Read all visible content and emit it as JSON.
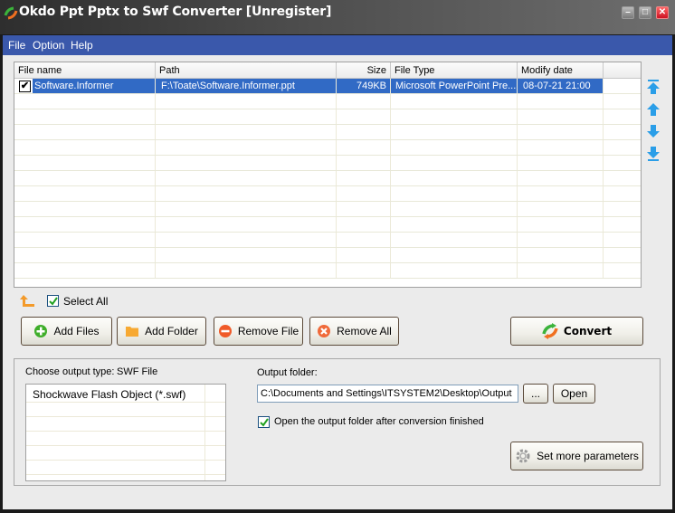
{
  "window": {
    "title": "Okdo Ppt Pptx to Swf Converter [Unregister]",
    "controls": {
      "minimize": "–",
      "maximize": "□",
      "close": "✕"
    }
  },
  "menu": [
    "File",
    "Option",
    "Help"
  ],
  "file_list": {
    "columns": [
      "File name",
      "Path",
      "Size",
      "File Type",
      "Modify date"
    ],
    "rows": [
      {
        "checked": true,
        "selected": true,
        "name": "Software.Informer",
        "path": "F:\\Toate\\Software.Informer.ppt",
        "size": "749KB",
        "type": "Microsoft PowerPoint Pre...",
        "date": "08-07-21 21:00"
      }
    ],
    "empty_rows": 12
  },
  "side_arrows": [
    "move-top-icon",
    "move-up-icon",
    "move-down-icon",
    "move-bottom-icon"
  ],
  "select_all": {
    "label": "Select All",
    "checked": true
  },
  "buttons": {
    "add_files": "Add Files",
    "add_folder": "Add Folder",
    "remove_file": "Remove File",
    "remove_all": "Remove All",
    "convert": "Convert",
    "browse": "...",
    "open": "Open",
    "set_more_parameters": "Set more parameters"
  },
  "output": {
    "type_label": "Choose output type:",
    "type_value": "SWF File",
    "types": [
      "Shockwave Flash Object (*.swf)"
    ],
    "folder_label": "Output folder:",
    "folder_value": "C:\\Documents and Settings\\ITSYSTEM2\\Desktop\\Output",
    "open_after_label": "Open the output folder after conversion finished",
    "open_after_checked": true
  },
  "colors": {
    "menubar": "#3a58ab",
    "selection": "#316ac5",
    "window_bg": "#ebebeb"
  }
}
